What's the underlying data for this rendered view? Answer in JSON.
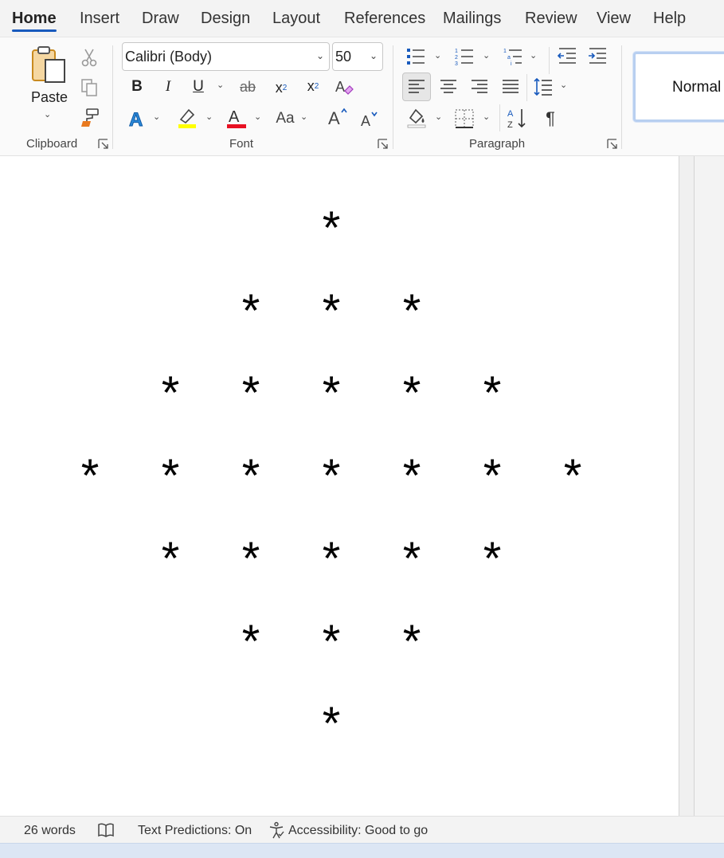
{
  "tabs": [
    "Home",
    "Insert",
    "Draw",
    "Design",
    "Layout",
    "References",
    "Mailings",
    "Review",
    "View",
    "Help"
  ],
  "clipboard": {
    "paste_label": "Paste",
    "group_label": "Clipboard"
  },
  "font": {
    "name": "Calibri (Body)",
    "size": "50",
    "group_label": "Font",
    "change_case_label": "Aa",
    "highlight_color": "#ffff00",
    "font_color": "#e81123"
  },
  "paragraph": {
    "group_label": "Paragraph"
  },
  "styles": {
    "normal_label": "Normal"
  },
  "document": {
    "rows": [
      [
        "*"
      ],
      [
        "*",
        "*",
        "*"
      ],
      [
        "*",
        "*",
        "*",
        "*",
        "*"
      ],
      [
        "*",
        "*",
        "*",
        "*",
        "*",
        "*",
        "*"
      ],
      [
        "*",
        "*",
        "*",
        "*",
        "*"
      ],
      [
        "*",
        "*",
        "*"
      ],
      [
        "*"
      ]
    ]
  },
  "status": {
    "word_count": "26 words",
    "text_predictions": "Text Predictions: On",
    "accessibility": "Accessibility: Good to go"
  }
}
